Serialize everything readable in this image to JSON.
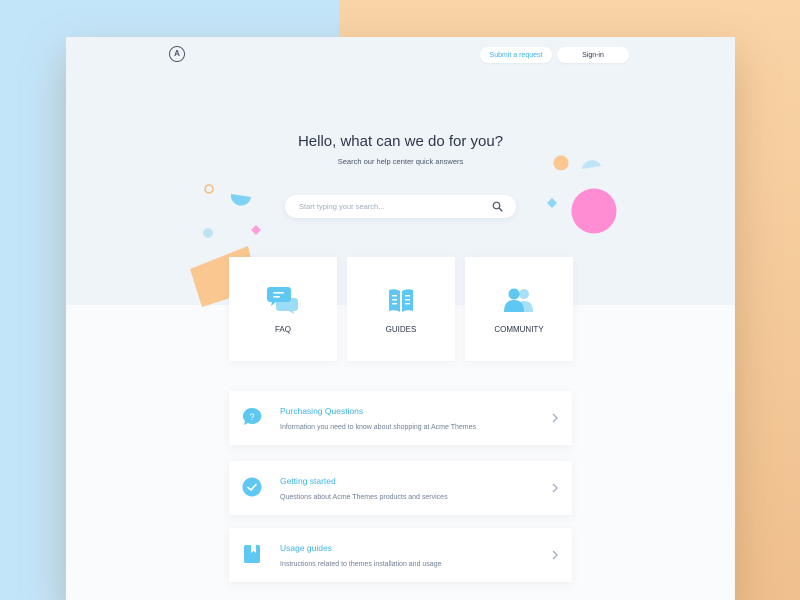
{
  "header": {
    "logo_letter": "A",
    "submit_request_label": "Submit a request",
    "sign_in_label": "Sign-in"
  },
  "hero": {
    "title": "Hello, what can we do for you?",
    "subtitle": "Search our help center quick answers",
    "search_placeholder": "Start typing your search...",
    "search_value": ""
  },
  "categories": [
    {
      "label": "FAQ",
      "icon": "chat-bubbles-icon"
    },
    {
      "label": "GUIDES",
      "icon": "open-book-icon"
    },
    {
      "label": "COMMUNITY",
      "icon": "people-icon"
    }
  ],
  "topics": [
    {
      "title": "Purchasing Questions",
      "description": "Information you need to know about shopping at Acme Themes",
      "icon": "question-bubble-icon"
    },
    {
      "title": "Getting started",
      "description": "Questions about Acme Themes products and services",
      "icon": "check-circle-icon"
    },
    {
      "title": "Usage guides",
      "description": "Instructions related to themes installation and usage",
      "icon": "bookmark-icon"
    }
  ],
  "colors": {
    "accent": "#3BB3E6",
    "icon_blue": "#63C9F2",
    "pink": "#FF8DD3",
    "peach": "#F9C78F",
    "hero_bg": "#EFF4F9"
  }
}
